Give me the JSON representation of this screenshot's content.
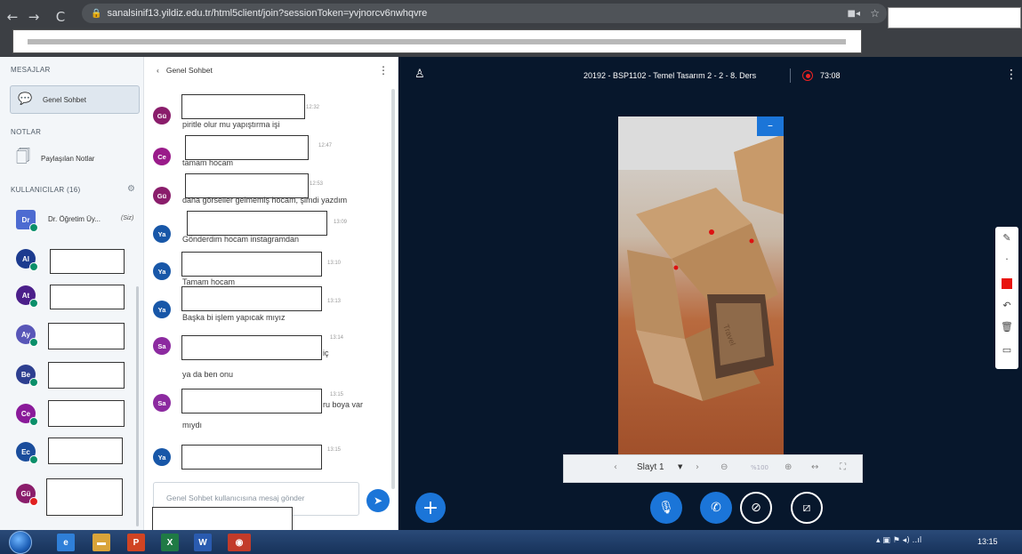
{
  "browser": {
    "url": "sanalsinif13.yildiz.edu.tr/html5client/join?sessionToken=yvjnorcv6nwhqvre",
    "back_icon": "arrow-left",
    "forward_icon": "arrow-right",
    "reload_icon": "reload"
  },
  "left_panel": {
    "messages_title": "MESAJLAR",
    "public_chat_label": "Genel Sohbet",
    "notes_title": "NOTLAR",
    "shared_notes_label": "Paylaşılan Notlar",
    "users_title": "KULLANICILAR (16)",
    "presenter": {
      "initials": "Dr",
      "name": "Dr. Öğretim Üy...",
      "you_tag": "(Siz)",
      "color": "#4d6bd1"
    },
    "users": [
      {
        "initials": "Al",
        "color": "#1c3b8f"
      },
      {
        "initials": "At",
        "color": "#4b1f8a"
      },
      {
        "initials": "Ay",
        "color": "#5856b8"
      },
      {
        "initials": "Be",
        "color": "#2d3f90"
      },
      {
        "initials": "Ce",
        "color": "#8a1a9a"
      },
      {
        "initials": "Ec",
        "color": "#1a4d9c"
      },
      {
        "initials": "Gü",
        "color": "#8a1d6b"
      }
    ]
  },
  "chat": {
    "header": "Genel Sohbet",
    "messages": [
      {
        "initials": "Gü",
        "color": "#8a1d6b",
        "time": "12:32",
        "text": "piritle olur mu yapıştırma işi"
      },
      {
        "initials": "Ce",
        "color": "#9a1b8a",
        "time": "12:47",
        "text": "tamam hocam"
      },
      {
        "initials": "Gü",
        "color": "#8a1d6b",
        "time": "12:53",
        "text": "daha görseller gelmemiş hocam, şimdi yazdım"
      },
      {
        "initials": "Ya",
        "color": "#1857a8",
        "time": "13:09",
        "text": "Gönderdim hocam instagramdan"
      },
      {
        "initials": "Ya",
        "color": "#1857a8",
        "time": "13:10",
        "text": "Tamam hocam"
      },
      {
        "initials": "Ya",
        "color": "#1857a8",
        "time": "13:13",
        "text": "Başka bi işlem yapıcak mıyız"
      },
      {
        "initials": "Sa",
        "color": "#8c2aa0",
        "time": "13:14",
        "text": "iç",
        "text2": "ya da ben onu"
      },
      {
        "initials": "Sa",
        "color": "#8c2aa0",
        "time": "13:15",
        "text": "ru boya var",
        "text2": "mıydı"
      },
      {
        "initials": "Ya",
        "color": "#1857a8",
        "time": "13:15",
        "text": ""
      }
    ],
    "input_placeholder": "Genel Sohbet kullanıcısına mesaj gönder",
    "send_icon": "send"
  },
  "presentation": {
    "title": "20192 - BSP1102 - Temel Tasarım 2 - 2 - 8. Ders",
    "record_time": "73:08",
    "slide_label": "Slayt 1",
    "zoom": "%100",
    "slide_text": "Travel",
    "tools": [
      "pencil",
      "dot",
      "red-color",
      "undo",
      "trash",
      "whiteboard"
    ],
    "accent": "#1b75d8"
  },
  "taskbar": {
    "clock": "13:15",
    "apps": [
      {
        "name": "ie",
        "letter": "e",
        "color": "#2f7fd8"
      },
      {
        "name": "explorer",
        "letter": "▬",
        "color": "#d9a43a"
      },
      {
        "name": "powerpoint",
        "letter": "P",
        "color": "#d04423"
      },
      {
        "name": "excel",
        "letter": "X",
        "color": "#1f7a45"
      },
      {
        "name": "word",
        "letter": "W",
        "color": "#2a5bb0"
      },
      {
        "name": "chrome",
        "letter": "◉",
        "color": "#c23b2a"
      }
    ]
  }
}
